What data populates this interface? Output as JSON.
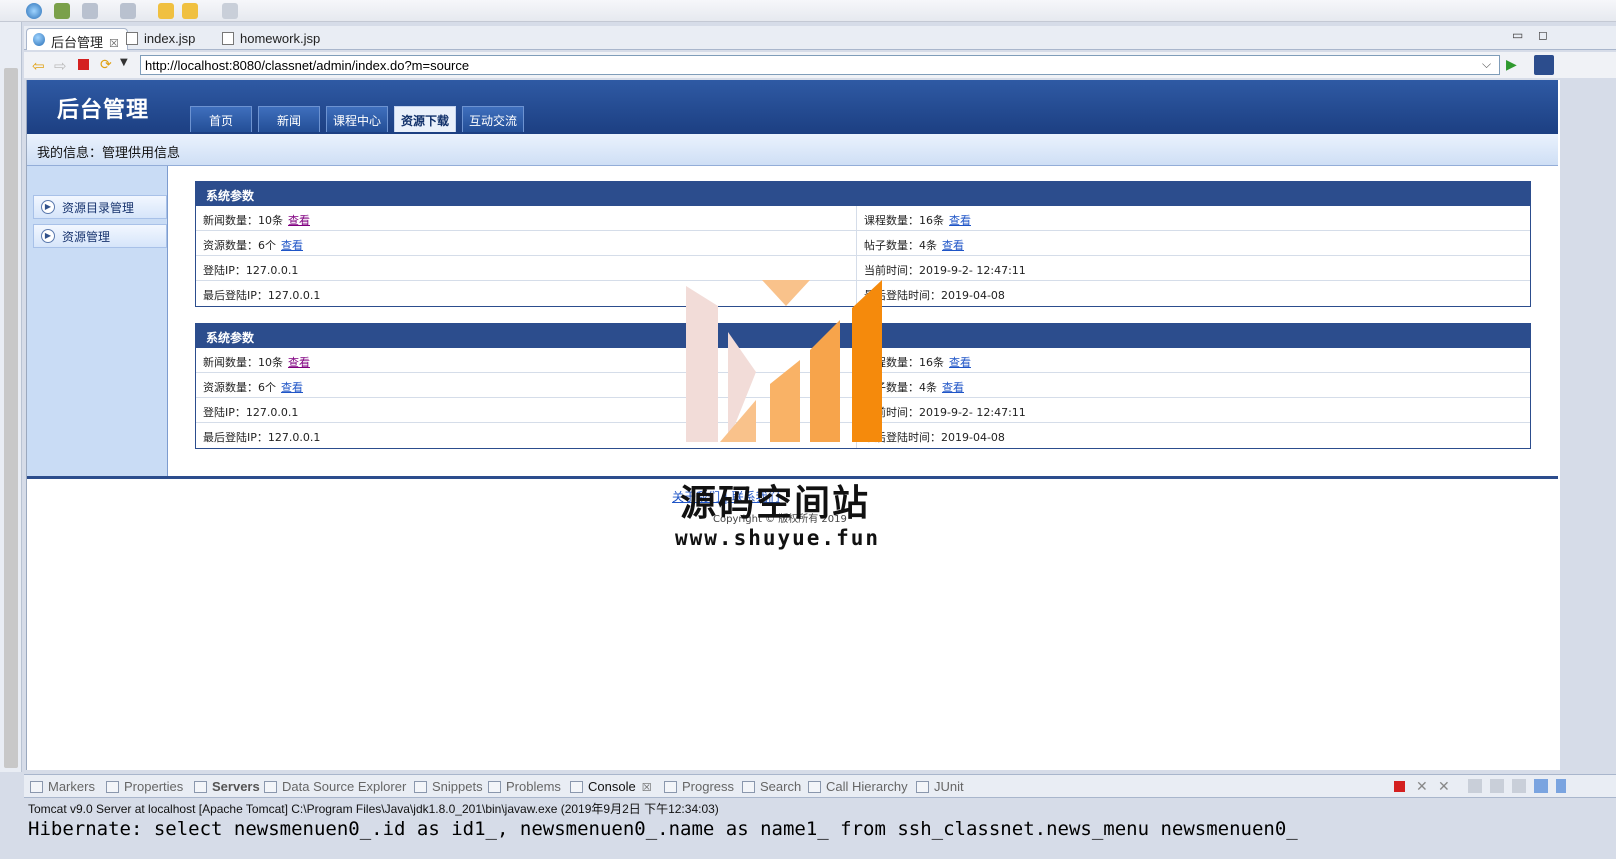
{
  "editor": {
    "tabs": [
      {
        "label": "后台管理",
        "active": true
      },
      {
        "label": "index.jsp",
        "active": false
      },
      {
        "label": "homework.jsp",
        "active": false
      }
    ],
    "close_glyph": "☒"
  },
  "browser": {
    "url": "http://localhost:8080/classnet/admin/index.do?m=source"
  },
  "app": {
    "title": "后台管理",
    "nav": [
      {
        "label": "首页",
        "active": false
      },
      {
        "label": "新闻",
        "active": false
      },
      {
        "label": "课程中心",
        "active": false
      },
      {
        "label": "资源下载",
        "active": true
      },
      {
        "label": "互动交流",
        "active": false
      }
    ],
    "info": "我的信息：管理供用信息",
    "left_menu": [
      "资源目录管理",
      "资源管理"
    ],
    "panels": [
      {
        "title": "系统参数",
        "rows": [
          {
            "left_label": "新闻数量：",
            "left_value": "10条",
            "left_link": "查看",
            "right_label": "课程数量：",
            "right_value": "16条",
            "right_link": "查看"
          },
          {
            "left_label": "资源数量：",
            "left_value": "6个",
            "left_link": "查看",
            "right_label": "帖子数量：",
            "right_value": "4条",
            "right_link": "查看"
          },
          {
            "left_label": "登陆IP：",
            "left_value": "127.0.0.1",
            "left_link": "",
            "right_label": "当前时间：",
            "right_value": "2019-9-2- 12:47:11",
            "right_link": ""
          },
          {
            "left_label": "最后登陆IP：",
            "left_value": "127.0.0.1",
            "left_link": "",
            "right_label": "最后登陆时间：",
            "right_value": "2019-04-08",
            "right_link": ""
          }
        ]
      },
      {
        "title": "系统参数",
        "rows": [
          {
            "left_label": "新闻数量：",
            "left_value": "10条",
            "left_link": "查看",
            "right_label": "课程数量：",
            "right_value": "16条",
            "right_link": "查看"
          },
          {
            "left_label": "资源数量：",
            "left_value": "6个",
            "left_link": "查看",
            "right_label": "帖子数量：",
            "right_value": "4条",
            "right_link": "查看"
          },
          {
            "left_label": "登陆IP：",
            "left_value": "127.0.0.1",
            "left_link": "",
            "right_label": "当前时间：",
            "right_value": "2019-9-2- 12:47:11",
            "right_link": ""
          },
          {
            "left_label": "最后登陆IP：",
            "left_value": "127.0.0.1",
            "left_link": "",
            "right_label": "最后登陆时间：",
            "right_value": "2019-04-08",
            "right_link": ""
          }
        ]
      }
    ],
    "footer_links": "关于我们 | 联系我们",
    "copyright": "Copyright © 版权所有 2019"
  },
  "watermark": {
    "text": "源码空间站",
    "url": "www.shuyue.fun",
    "colors": [
      "#f2dcd8",
      "#f9c28b",
      "#f7a44b",
      "#f58a0c"
    ]
  },
  "views": {
    "tabs": [
      {
        "label": "Markers",
        "active": false,
        "bold": false
      },
      {
        "label": "Properties",
        "active": false,
        "bold": false
      },
      {
        "label": "Servers",
        "active": false,
        "bold": true
      },
      {
        "label": "Data Source Explorer",
        "active": false,
        "bold": false
      },
      {
        "label": "Snippets",
        "active": false,
        "bold": false
      },
      {
        "label": "Problems",
        "active": false,
        "bold": false
      },
      {
        "label": "Console",
        "active": true,
        "bold": false
      },
      {
        "label": "Progress",
        "active": false,
        "bold": false
      },
      {
        "label": "Search",
        "active": false,
        "bold": false
      },
      {
        "label": "Call Hierarchy",
        "active": false,
        "bold": false
      },
      {
        "label": "JUnit",
        "active": false,
        "bold": false
      }
    ],
    "console_header": "Tomcat v9.0 Server at localhost [Apache Tomcat] C:\\Program Files\\Java\\jdk1.8.0_201\\bin\\javaw.exe (2019年9月2日 下午12:34:03)",
    "console_output": "Hibernate: select newsmenuen0_.id as id1_, newsmenuen0_.name as name1_ from ssh_classnet.news_menu newsmenuen0_"
  }
}
